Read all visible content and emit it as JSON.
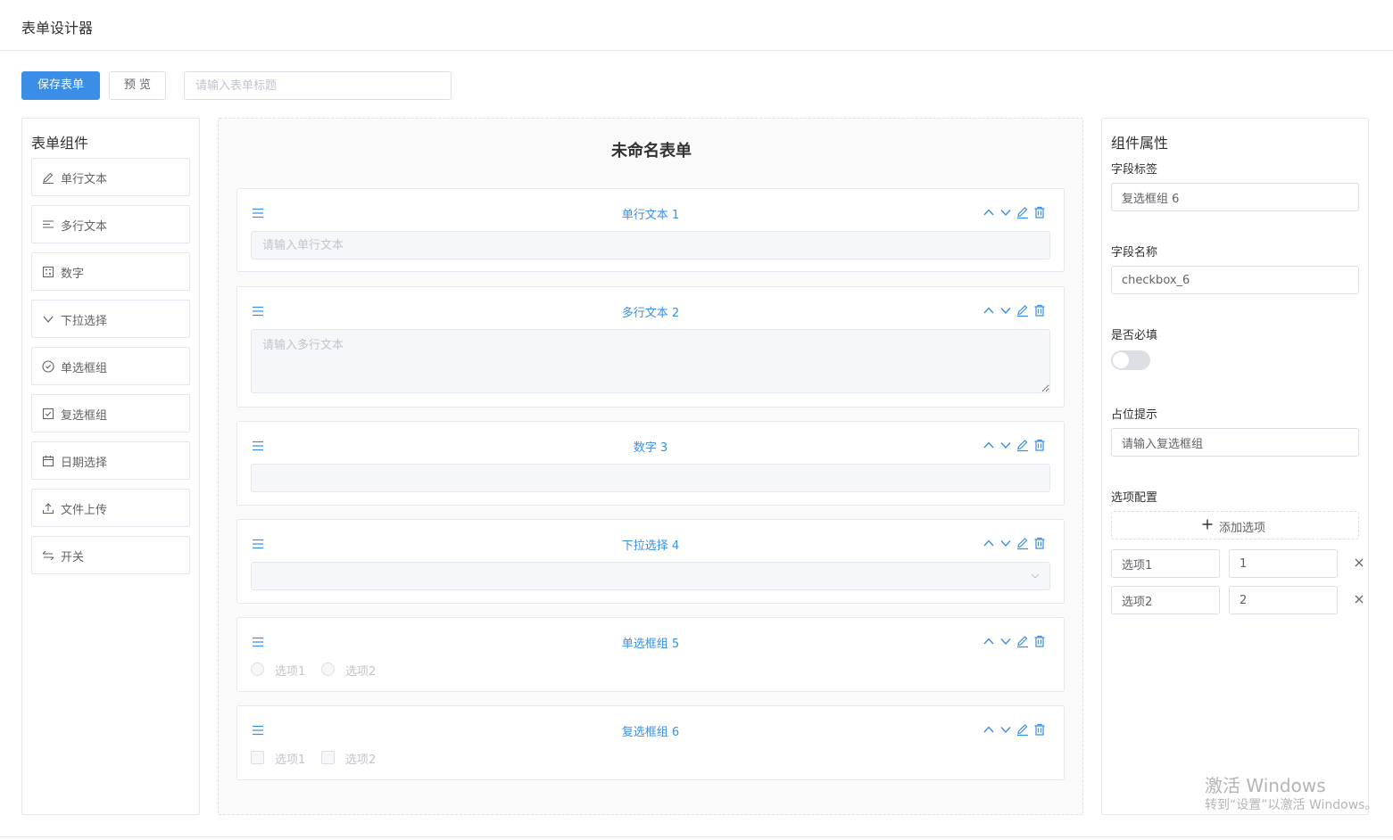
{
  "app": {
    "title": "表单设计器"
  },
  "toolbar": {
    "save_label": "保存表单",
    "preview_label": "预 览",
    "title_placeholder": "请输入表单标题"
  },
  "components_panel": {
    "title": "表单组件",
    "items": [
      {
        "label": "单行文本",
        "icon": "pencil-icon"
      },
      {
        "label": "多行文本",
        "icon": "lines-icon"
      },
      {
        "label": "数字",
        "icon": "calculator-icon"
      },
      {
        "label": "下拉选择",
        "icon": "chevron-down-icon"
      },
      {
        "label": "单选框组",
        "icon": "circle-check-icon"
      },
      {
        "label": "复选框组",
        "icon": "checkbox-icon"
      },
      {
        "label": "日期选择",
        "icon": "calendar-icon"
      },
      {
        "label": "文件上传",
        "icon": "upload-icon"
      },
      {
        "label": "开关",
        "icon": "switch-arrows-icon"
      }
    ]
  },
  "canvas": {
    "form_title": "未命名表单",
    "fields": [
      {
        "label": "单行文本 1",
        "placeholder": "请输入单行文本"
      },
      {
        "label": "多行文本 2",
        "placeholder": "请输入多行文本"
      },
      {
        "label": "数字 3"
      },
      {
        "label": "下拉选择 4"
      },
      {
        "label": "单选框组 5",
        "options": [
          "选项1",
          "选项2"
        ]
      },
      {
        "label": "复选框组 6",
        "options": [
          "选项1",
          "选项2"
        ]
      }
    ]
  },
  "properties": {
    "title": "组件属性",
    "field_label_caption": "字段标签",
    "field_label_value": "复选框组 6",
    "field_name_caption": "字段名称",
    "field_name_value": "checkbox_6",
    "required_caption": "是否必填",
    "required": false,
    "placeholder_caption": "占位提示",
    "placeholder_value": "请输入复选框组",
    "options_caption": "选项配置",
    "add_option_label": "添加选项",
    "options": [
      {
        "label": "选项1",
        "value": "1"
      },
      {
        "label": "选项2",
        "value": "2"
      }
    ]
  },
  "watermark": {
    "line1": "激活 Windows",
    "line2": "转到“设置”以激活 Windows。"
  },
  "colors": {
    "primary": "#3a8ee6",
    "border": "#e4e7ed"
  }
}
